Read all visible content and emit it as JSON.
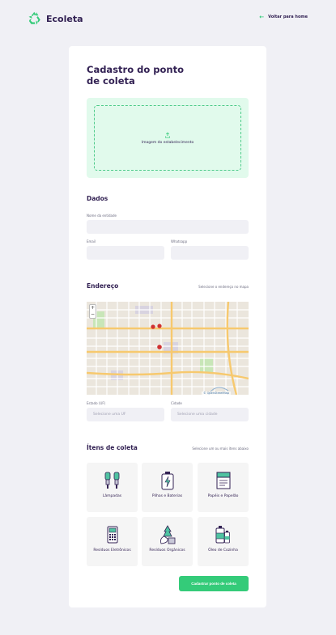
{
  "header": {
    "app_name": "Ecoleta",
    "back_link": "Voltar para home"
  },
  "form": {
    "title": "Cadastro do ponto de coleta",
    "dropzone_label": "Imagem do estabelecimento",
    "dados": {
      "title": "Dados",
      "name_label": "Nome da entidade",
      "name_value": "",
      "email_label": "Email",
      "email_value": "",
      "whatsapp_label": "Whatsapp",
      "whatsapp_value": ""
    },
    "endereco": {
      "title": "Endereço",
      "hint": "Selecione o endereço no mapa",
      "map_zoom_in": "+",
      "map_zoom_out": "−",
      "map_attribution": "© OpenStreetMap",
      "uf_label": "Estado (UF)",
      "uf_selected": "Selecione uma UF",
      "city_label": "Cidade",
      "city_selected": "Selecione uma cidade"
    },
    "itens": {
      "title": "Ítens de coleta",
      "hint": "Selecione um ou mais ítens abaixo",
      "list": [
        {
          "label": "Lâmpadas",
          "icon": "lamp-icon"
        },
        {
          "label": "Pilhas e Baterias",
          "icon": "battery-icon"
        },
        {
          "label": "Papéis e Papelão",
          "icon": "paper-icon"
        },
        {
          "label": "Resíduos Eletrônicos",
          "icon": "electronics-icon"
        },
        {
          "label": "Resíduos Orgânicos",
          "icon": "organic-icon"
        },
        {
          "label": "Óleo de Cozinha",
          "icon": "oil-icon"
        }
      ]
    },
    "submit_label": "Cadastrar ponto de coleta"
  },
  "colors": {
    "primary": "#34cb79",
    "title": "#322153",
    "text": "#6c6c80",
    "background": "#f0f0f5",
    "dropzone": "#e1faec"
  }
}
